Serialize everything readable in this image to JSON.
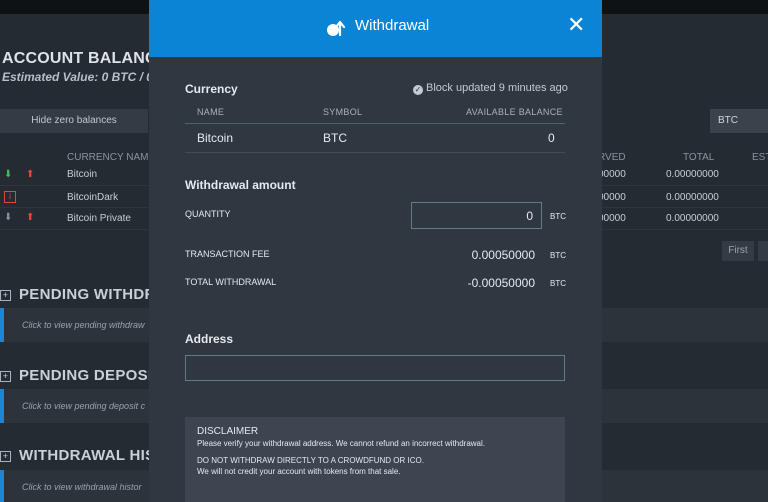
{
  "background": {
    "title": "ACCOUNT BALANCES",
    "estimated": "Estimated Value: 0 BTC / 0",
    "hide_zero": "Hide zero balances",
    "currency_select": "BTC",
    "columns": {
      "currency_name": "CURRENCY NAME",
      "reserved": "RVED",
      "total": "TOTAL",
      "est": "EST"
    },
    "rows": [
      {
        "name": "Bitcoin",
        "reserved": "00000",
        "total": "0.00000000"
      },
      {
        "name": "BitcoinDark",
        "reserved": "00000",
        "total": "0.00000000"
      },
      {
        "name": "Bitcoin Private",
        "reserved": "00000",
        "total": "0.00000000"
      }
    ],
    "first_button": "First",
    "sections": [
      {
        "title": "PENDING WITHDRA",
        "hint": "Click to view pending withdraw"
      },
      {
        "title": "PENDING DEPOSI",
        "hint": "Click to view pending deposit c"
      },
      {
        "title": "WITHDRAWAL HIS",
        "hint": "Click to view withdrawal histor"
      }
    ]
  },
  "modal": {
    "title": "Withdrawal",
    "currency_label": "Currency",
    "block_updated": "Block updated 9 minutes ago",
    "table": {
      "headers": {
        "name": "NAME",
        "symbol": "SYMBOL",
        "balance": "AVAILABLE BALANCE"
      },
      "row": {
        "name": "Bitcoin",
        "symbol": "BTC",
        "balance": "0"
      }
    },
    "withdrawal_label": "Withdrawal amount",
    "quantity_label": "QUANTITY",
    "quantity_value": "0",
    "unit": "BTC",
    "fee_label": "TRANSACTION FEE",
    "fee_value": "0.00050000",
    "total_label": "TOTAL WITHDRAWAL",
    "total_value": "-0.00050000",
    "address_label": "Address",
    "address_value": "",
    "disclaimer": {
      "title": "DISCLAIMER",
      "line1": "Please verify your withdrawal address. We cannot refund an incorrect withdrawal.",
      "line2": "DO NOT WITHDRAW DIRECTLY TO A CROWDFUND OR ICO.",
      "line3": "We will not credit your account with tokens from that sale."
    },
    "colors": {
      "header": "#0a84d4",
      "body": "#2f3741"
    }
  }
}
